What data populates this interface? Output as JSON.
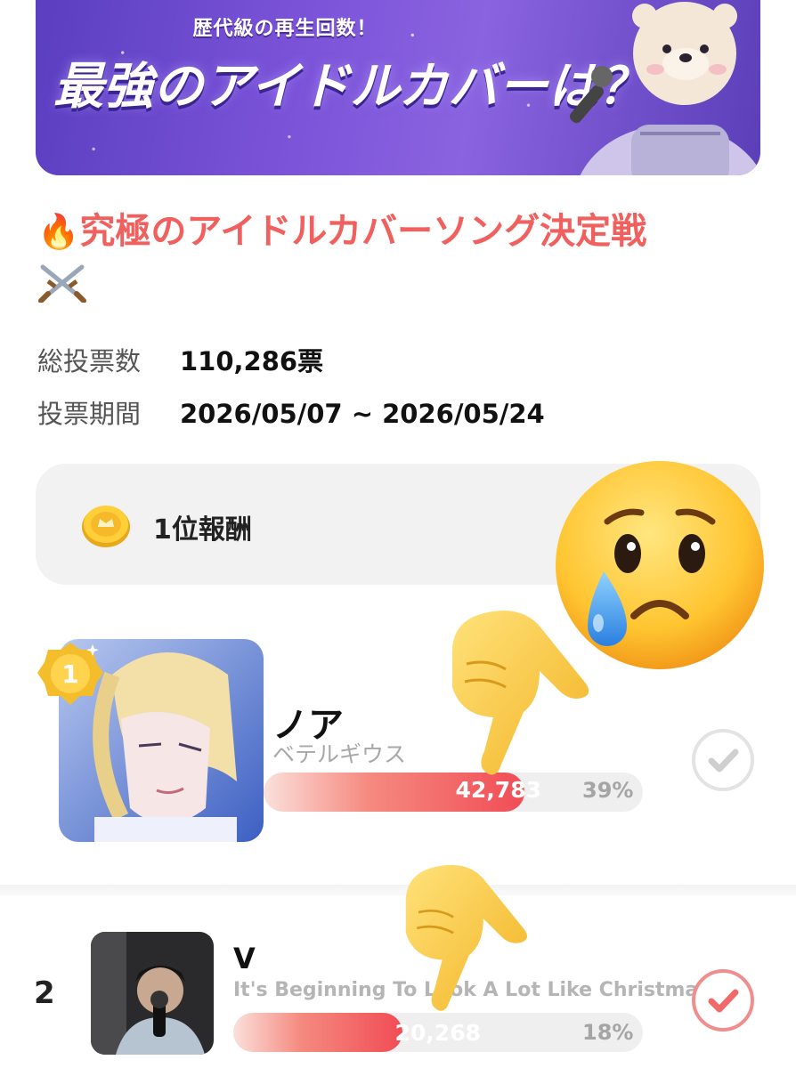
{
  "banner": {
    "subtitle": "歴代級の再生回数！",
    "title": "最強のアイドルカバーは？"
  },
  "contest": {
    "title": "究極のアイドルカバーソング決定戦",
    "fire_emoji": "🔥"
  },
  "info": {
    "total_votes_label": "総投票数",
    "total_votes_value": "110,286票",
    "period_label": "投票期間",
    "period_value": "2026/05/07 ~ 2026/05/24"
  },
  "reward": {
    "label": "1位報酬"
  },
  "entries": [
    {
      "rank": "1",
      "name": "ノア",
      "song": "ベテルギウス",
      "votes": "42,783",
      "percent": "39%",
      "fill_fraction": 0.39
    },
    {
      "rank": "2",
      "name": "V",
      "song": "It's Beginning To Look A Lot Like Christmas",
      "votes": "20,268",
      "percent": "18%",
      "fill_fraction": 0.18
    }
  ],
  "colors": {
    "accent": "#f0605e",
    "bar_end": "#f14c55",
    "banner": "#6a4bd0"
  },
  "icons": [
    "fire-icon",
    "crossed-swords-icon",
    "coin-icon",
    "crying-face-icon",
    "pointing-hand-icon",
    "checkmark-icon",
    "rank-medal-icon"
  ]
}
